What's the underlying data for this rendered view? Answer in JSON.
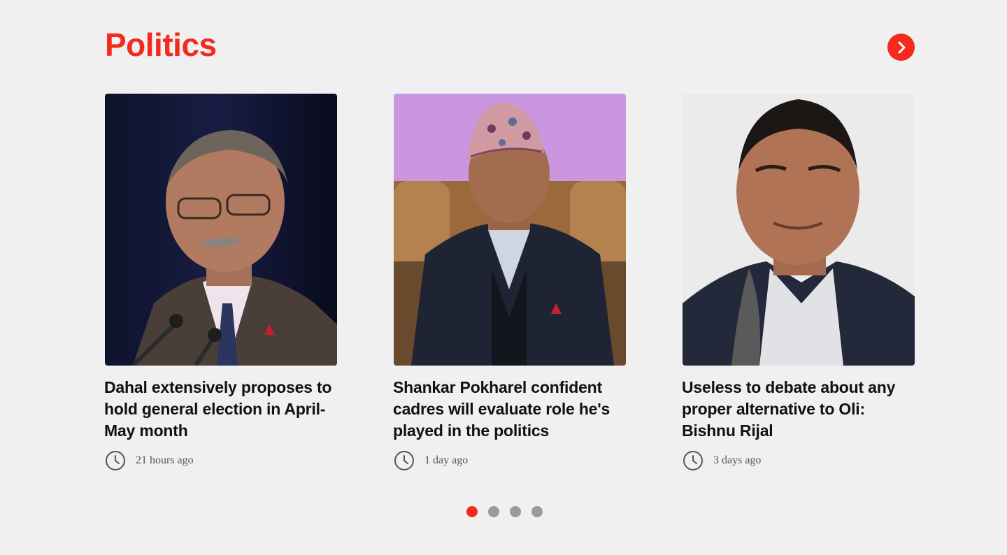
{
  "section": {
    "title": "Politics",
    "accent_color": "#f42a1f",
    "next_icon": "chevron-right-icon"
  },
  "articles": [
    {
      "headline": "Dahal extensively proposes to hold general election in April-May month",
      "time": "21 hours ago",
      "time_icon": "clock-icon"
    },
    {
      "headline": "Shankar Pokharel confident cadres will evaluate role he's played in the politics",
      "time": "1 day ago",
      "time_icon": "clock-icon"
    },
    {
      "headline": "Useless to debate about any proper alternative to Oli: Bishnu Rijal",
      "time": "3 days ago",
      "time_icon": "clock-icon"
    }
  ],
  "pagination": {
    "pages": 4,
    "active": 1
  }
}
